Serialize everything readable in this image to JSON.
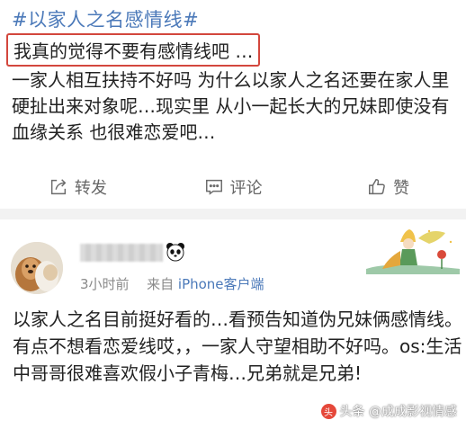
{
  "post1": {
    "hashtag": "#以家人之名感情线#",
    "title": "我真的觉得不要有感情线吧 …",
    "body": "一家人相互扶持不好吗 为什么以家人之名还要在家人里硬扯出来对象呢…现实里 从小一起长大的兄妹即使没有血缘关系 也很难恋爱吧…",
    "actions": {
      "repost": "转发",
      "comment": "评论",
      "like": "赞"
    }
  },
  "post2": {
    "time": "3小时前",
    "from": "来自",
    "source": "iPhone客户端",
    "body": "以家人之名目前挺好看的…看预告知道伪兄妹俩感情线。有点不想看恋爱线哎，，一家人守望相助不好吗。os:生活中哥哥很难喜欢假小子青梅…兄弟就是兄弟!"
  },
  "watermark": {
    "text": "头条 @成成影视情感"
  },
  "colors": {
    "link_blue": "#4b79b9",
    "highlight_red": "#d3473d",
    "muted_gray": "#8a8a8a"
  },
  "icons": [
    "repost-icon",
    "comment-icon",
    "like-icon",
    "panda-icon",
    "avatar-dog-image",
    "little-prince-decoration"
  ]
}
